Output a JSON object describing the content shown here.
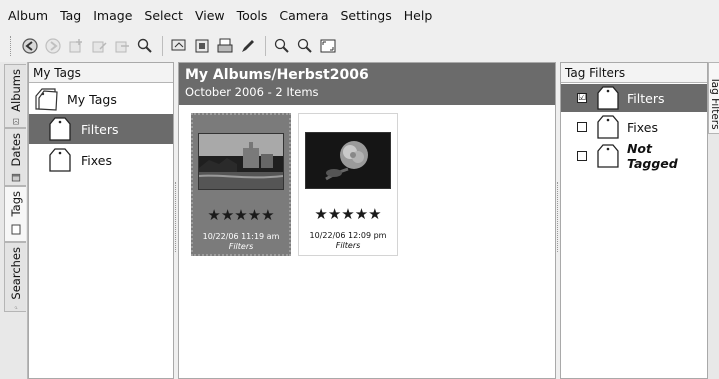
{
  "menubar": {
    "items": [
      "Album",
      "Tag",
      "Image",
      "Select",
      "View",
      "Tools",
      "Camera",
      "Settings",
      "Help"
    ]
  },
  "toolbar": {
    "buttons": [
      {
        "icon": "back-icon",
        "enabled": true
      },
      {
        "icon": "forward-icon",
        "enabled": false
      },
      {
        "icon": "tag-add-icon",
        "enabled": false
      },
      {
        "icon": "tag-edit-icon",
        "enabled": false
      },
      {
        "icon": "tag-remove-icon",
        "enabled": false
      },
      {
        "icon": "find-icon",
        "enabled": true
      },
      {
        "icon": "slideshow-icon",
        "enabled": true
      },
      {
        "icon": "view-images-icon",
        "enabled": true
      },
      {
        "icon": "print-icon",
        "enabled": true
      },
      {
        "icon": "edit-pencil-icon",
        "enabled": true
      },
      {
        "icon": "zoom-in-icon",
        "enabled": true
      },
      {
        "icon": "zoom-out-icon",
        "enabled": true
      },
      {
        "icon": "fullscreen-icon",
        "enabled": true
      }
    ]
  },
  "left_tabs": [
    {
      "label": "Albums",
      "icon": "album-icon"
    },
    {
      "label": "Dates",
      "icon": "calendar-icon"
    },
    {
      "label": "Tags",
      "icon": "tag-icon",
      "active": true
    },
    {
      "label": "Searches",
      "icon": "search-icon"
    }
  ],
  "tags_panel": {
    "header": "My Tags",
    "root": {
      "label": "My Tags"
    },
    "children": [
      {
        "label": "Filters",
        "selected": true
      },
      {
        "label": "Fixes",
        "selected": false
      }
    ]
  },
  "album_view": {
    "title": "My Albums/Herbst2006",
    "subtitle": "October 2006 - 2 Items",
    "items": [
      {
        "date": "10/22/06 11:19 am",
        "tag": "Filters",
        "rating": "★★★★★",
        "selected": true
      },
      {
        "date": "10/22/06 12:09 pm",
        "tag": "Filters",
        "rating": "★★★★★",
        "selected": false
      }
    ]
  },
  "filter_panel": {
    "header": "Tag Filters",
    "items": [
      {
        "label": "Filters",
        "checked": true,
        "checkmark": "☑"
      },
      {
        "label": "Fixes",
        "checked": false,
        "checkmark": ""
      },
      {
        "label": "Not Tagged",
        "checked": false,
        "checkmark": ""
      }
    ]
  },
  "right_tabs": [
    {
      "label": "Tag Filters"
    }
  ],
  "colors": {
    "selection": "#6b6b6b",
    "panel_bg": "#ffffff",
    "window_bg": "#efefef"
  }
}
